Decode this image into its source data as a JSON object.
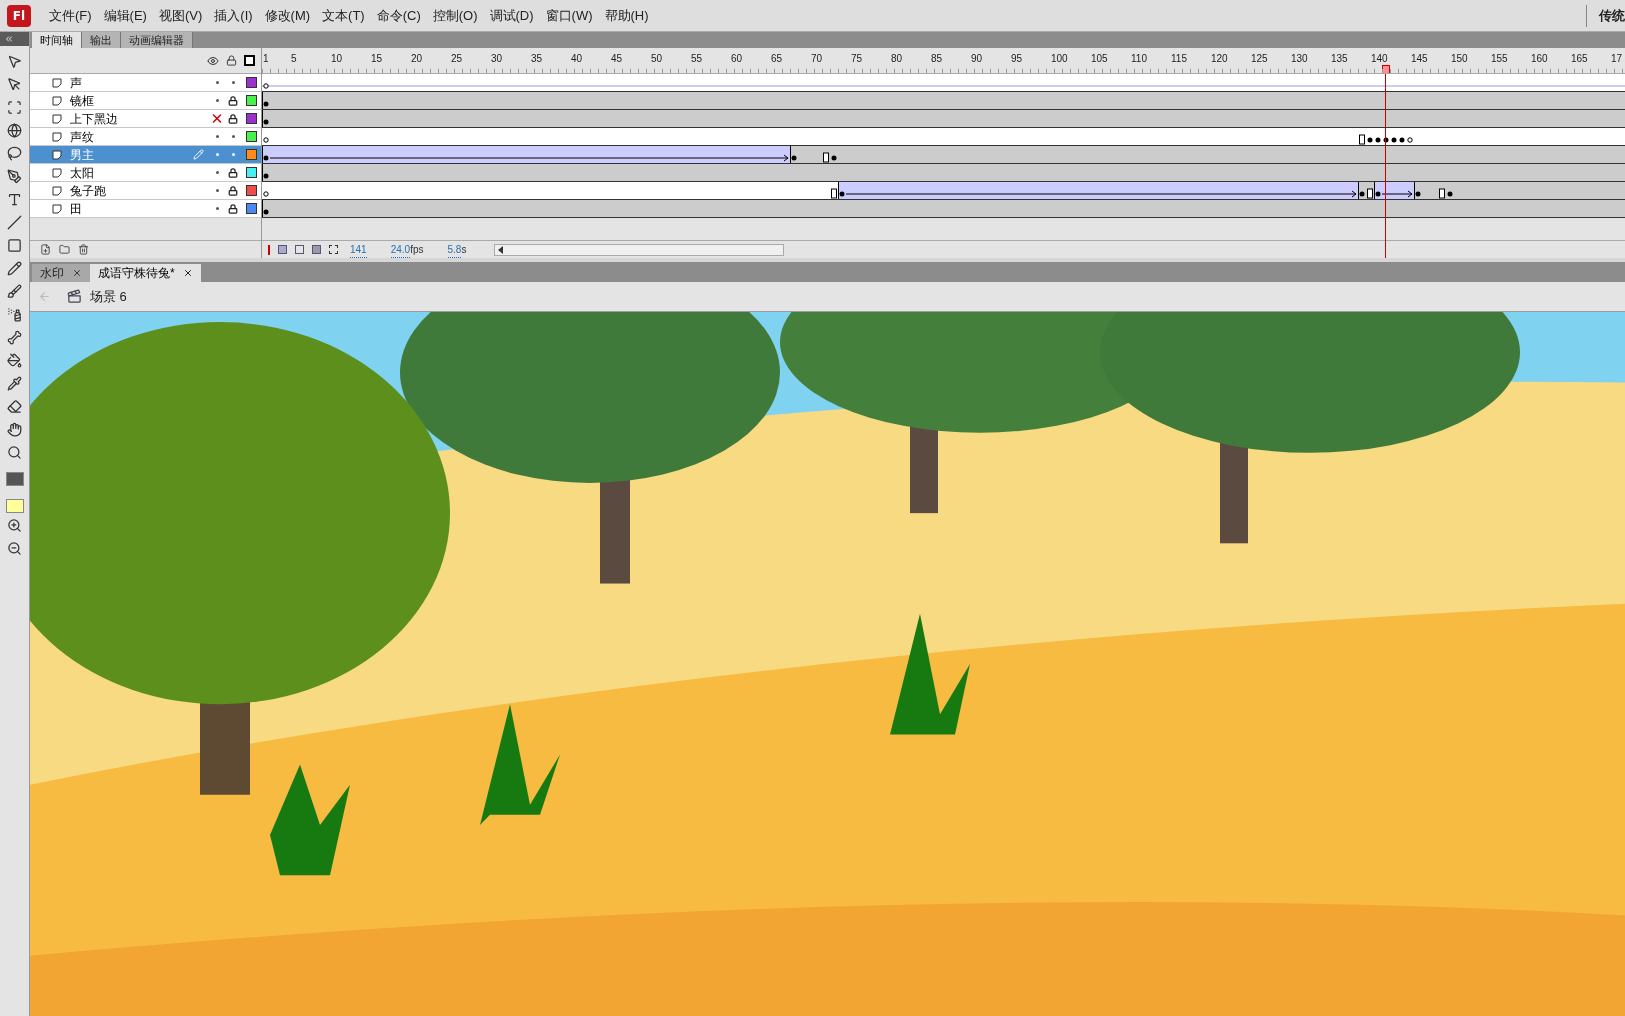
{
  "app": {
    "logo": "Fl",
    "menu": [
      "文件(F)",
      "编辑(E)",
      "视图(V)",
      "插入(I)",
      "修改(M)",
      "文本(T)",
      "命令(C)",
      "控制(O)",
      "调试(D)",
      "窗口(W)",
      "帮助(H)"
    ],
    "workspace": "传统"
  },
  "timeline": {
    "tabs": [
      {
        "label": "时间轴",
        "selected": true
      },
      {
        "label": "输出",
        "selected": false
      },
      {
        "label": "动画编辑器",
        "selected": false
      }
    ],
    "ruler_labels": [
      "1",
      "5",
      "10",
      "15",
      "20",
      "25",
      "30",
      "35",
      "40",
      "45",
      "50",
      "55",
      "60",
      "65",
      "70",
      "75",
      "80",
      "85",
      "90",
      "95",
      "100",
      "105",
      "110",
      "115",
      "120",
      "125",
      "130",
      "135",
      "140",
      "145",
      "150",
      "155",
      "160",
      "165",
      "17"
    ],
    "layers": [
      {
        "name": "声",
        "visible": true,
        "locked": false,
        "color": "#9933cc",
        "selected": false
      },
      {
        "name": "镜框",
        "visible": true,
        "locked": true,
        "color": "#4cef4c",
        "selected": false
      },
      {
        "name": "上下黑边",
        "visible": false,
        "locked": true,
        "color": "#9933cc",
        "selected": false
      },
      {
        "name": "声纹",
        "visible": true,
        "locked": false,
        "color": "#4cef4c",
        "selected": false
      },
      {
        "name": "男主",
        "visible": true,
        "locked": false,
        "color": "#ff8c1a",
        "selected": true
      },
      {
        "name": "太阳",
        "visible": true,
        "locked": true,
        "color": "#4cefef",
        "selected": false
      },
      {
        "name": "兔子跑",
        "visible": true,
        "locked": true,
        "color": "#ef4c4c",
        "selected": false
      },
      {
        "name": "田",
        "visible": true,
        "locked": true,
        "color": "#4c88ef",
        "selected": false
      }
    ],
    "current_frame": "141",
    "frame_rate": "24.0",
    "fps_unit": "fps",
    "elapsed": "5.8",
    "time_unit": "s"
  },
  "documents": {
    "tabs": [
      {
        "label": "水印",
        "selected": false
      },
      {
        "label": "成语守株待兔*",
        "selected": true
      }
    ],
    "scene": "场景 6"
  }
}
